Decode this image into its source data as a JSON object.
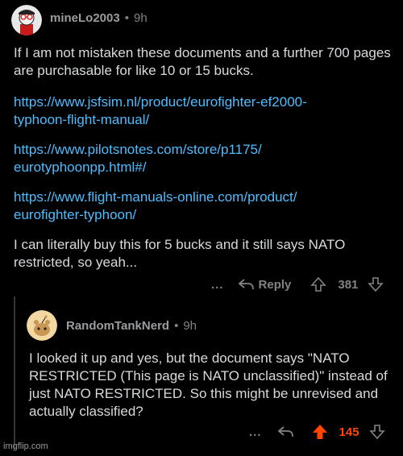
{
  "comment1": {
    "username": "mineLo2003",
    "time": "9h",
    "paragraph1": "If I am not mistaken these documents and a further 700 pages are purchasable for like 10 or 15 bucks.",
    "links": [
      [
        "https://www.jsfsim.nl/product/eurofighter-ef2000-",
        "typhoon-flight-manual/"
      ],
      [
        "https://www.pilotsnotes.com/store/p1175/",
        "eurotyphoonpp.html#/"
      ],
      [
        "https://www.flight-manuals-online.com/product/",
        "eurofighter-typhoon/"
      ]
    ],
    "paragraph2": "I can literally buy this for 5 bucks and it still says NATO restricted, so yeah...",
    "actions": {
      "more": "...",
      "reply": "Reply",
      "score": "381"
    }
  },
  "comment2": {
    "username": "RandomTankNerd",
    "time": "9h",
    "paragraph": "I looked it up and yes, but the document says \"NATO RESTRICTED (This page is NATO unclassified)\" instead of just NATO RESTRICTED. So this might be unrevised and actually classified?",
    "actions": {
      "more": "...",
      "score": "145"
    }
  },
  "watermark": "imgflip.com",
  "colors": {
    "link": "#4fbcff",
    "upvote": "#ff4500",
    "text": "#d7dadc",
    "muted": "#818384"
  }
}
